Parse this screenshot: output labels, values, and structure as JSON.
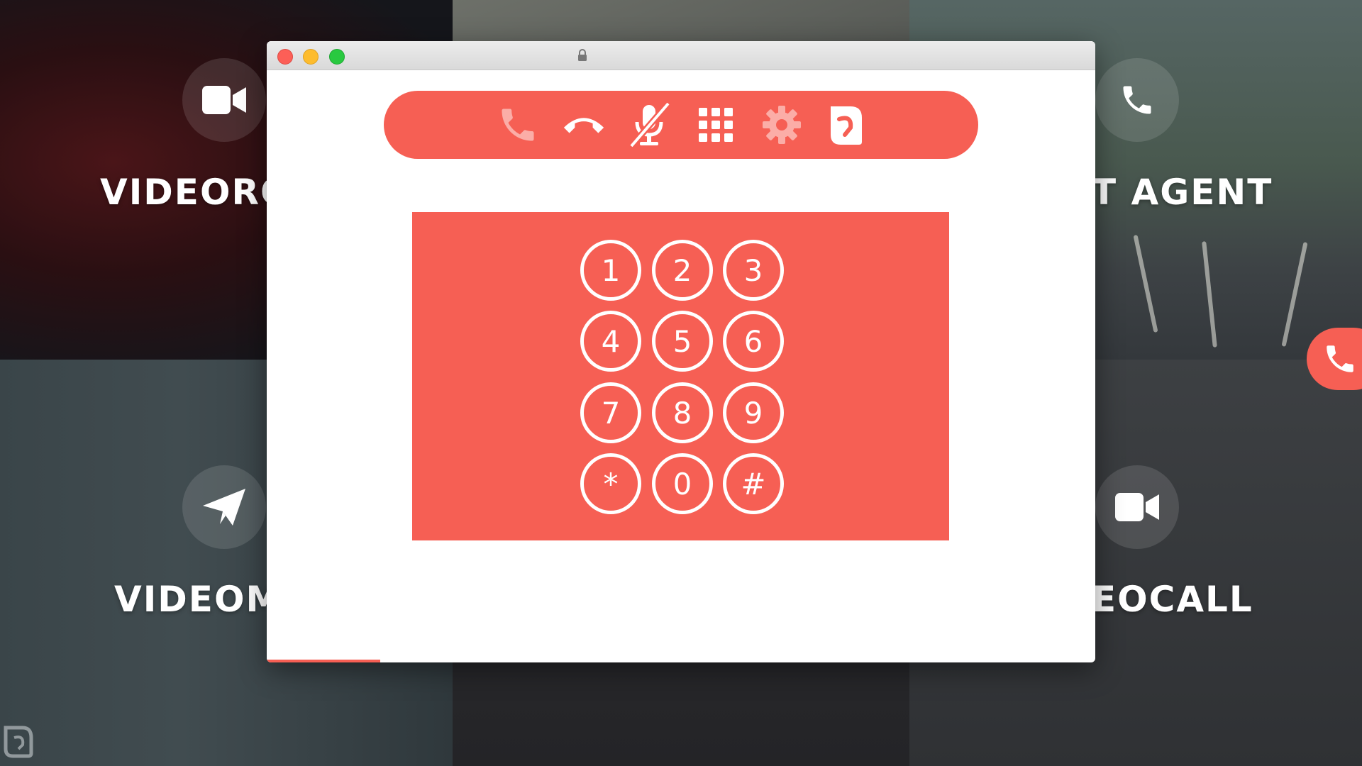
{
  "background": {
    "tiles": [
      {
        "label": "VIDEORO",
        "icon": "video-camera-icon"
      },
      {
        "label": "T AGENT",
        "icon": "phone-icon"
      },
      {
        "label": "VIDEOM",
        "icon": "paper-plane-icon"
      },
      {
        "label": "EOCALL",
        "icon": "video-camera-icon"
      }
    ],
    "side_call_icon": "phone-icon",
    "corner_logo_icon": "leaf-logo-icon"
  },
  "window": {
    "traffic_lights": [
      "close",
      "minimize",
      "maximize"
    ],
    "lock_icon": "lock-icon",
    "toolbar": {
      "buttons": [
        {
          "name": "call",
          "icon": "phone-icon",
          "state": "disabled"
        },
        {
          "name": "hangup",
          "icon": "hang-up-icon",
          "state": "enabled"
        },
        {
          "name": "mute",
          "icon": "microphone-muted-icon",
          "state": "enabled"
        },
        {
          "name": "dialpad",
          "icon": "grid-icon",
          "state": "active"
        },
        {
          "name": "settings",
          "icon": "gear-icon",
          "state": "disabled"
        },
        {
          "name": "logo",
          "icon": "leaf-logo-icon",
          "state": "enabled"
        }
      ]
    },
    "dialpad": {
      "keys": [
        "1",
        "2",
        "3",
        "4",
        "5",
        "6",
        "7",
        "8",
        "9",
        "*",
        "0",
        "#"
      ]
    }
  },
  "colors": {
    "accent": "#f65f54",
    "accent_dim": "#fbada7",
    "window_bg": "#ffffff"
  }
}
